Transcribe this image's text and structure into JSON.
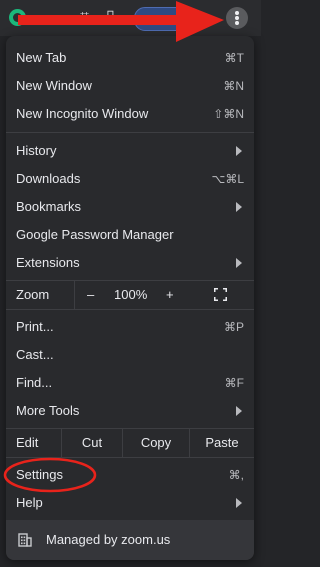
{
  "menu": {
    "items_group1": [
      {
        "label": "New Tab",
        "shortcut": "⌘T"
      },
      {
        "label": "New Window",
        "shortcut": "⌘N"
      },
      {
        "label": "New Incognito Window",
        "shortcut": "⇧⌘N"
      }
    ],
    "items_group2": [
      {
        "label": "History",
        "submenu": true
      },
      {
        "label": "Downloads",
        "shortcut": "⌥⌘L"
      },
      {
        "label": "Bookmarks",
        "submenu": true
      },
      {
        "label": "Google Password Manager"
      },
      {
        "label": "Extensions",
        "submenu": true
      }
    ],
    "zoom": {
      "label": "Zoom",
      "minus": "–",
      "level": "100%",
      "plus": "+"
    },
    "items_group3": [
      {
        "label": "Print...",
        "shortcut": "⌘P"
      },
      {
        "label": "Cast..."
      },
      {
        "label": "Find...",
        "shortcut": "⌘F"
      },
      {
        "label": "More Tools",
        "submenu": true
      }
    ],
    "edit": {
      "label": "Edit",
      "cut": "Cut",
      "copy": "Copy",
      "paste": "Paste"
    },
    "items_group4": [
      {
        "label": "Settings",
        "shortcut": "⌘,"
      },
      {
        "label": "Help",
        "submenu": true
      }
    ],
    "managed_label": "Managed by zoom.us"
  },
  "colors": {
    "annotation_red": "#e8231b",
    "menu_bg": "#292a2d",
    "text": "#e8e9ed"
  },
  "icons": {
    "extension": "green-circle-extension-icon",
    "menu_button": "three-dots-vertical-icon",
    "fullscreen": "fullscreen-icon",
    "managed": "building-icon",
    "submenu": "triangle-right-icon"
  }
}
